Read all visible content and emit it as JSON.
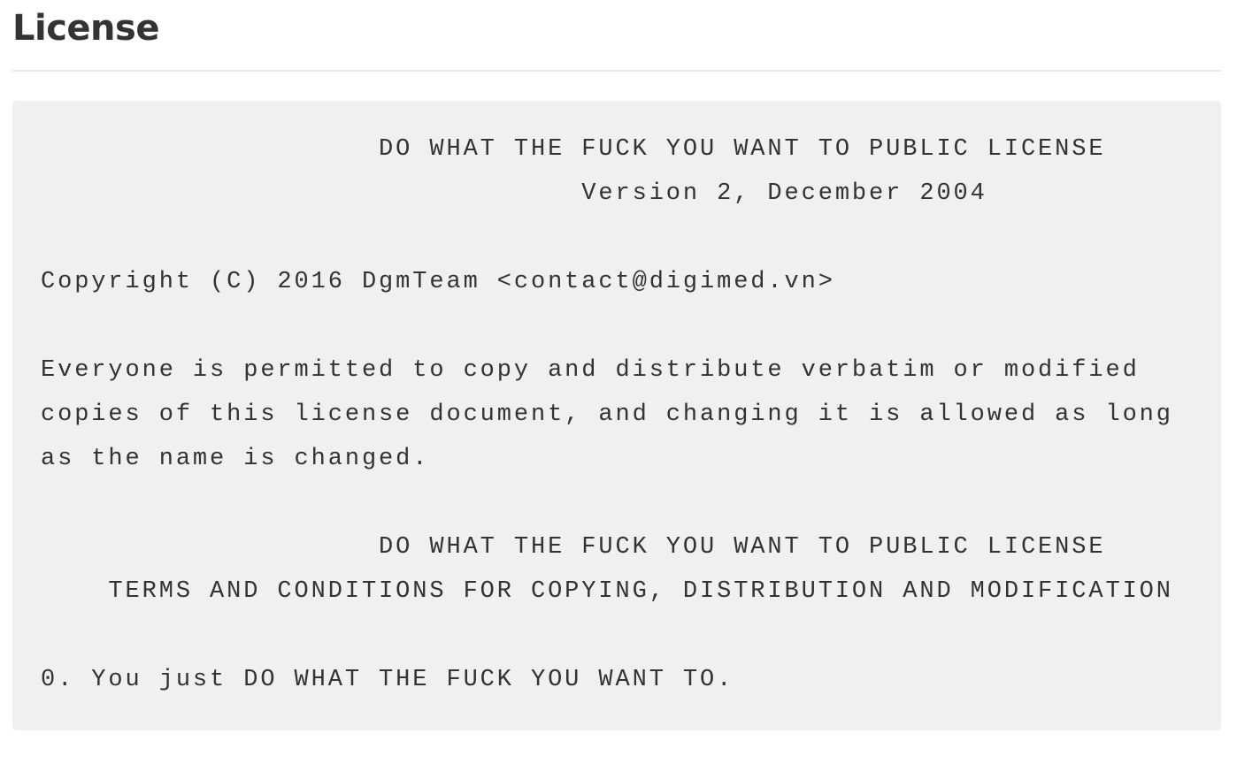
{
  "section": {
    "title": "License"
  },
  "license": {
    "text": "                    DO WHAT THE FUCK YOU WANT TO PUBLIC LICENSE\n                                Version 2, December 2004\n\nCopyright (C) 2016 DgmTeam <contact@digimed.vn>\n\nEveryone is permitted to copy and distribute verbatim or modified\ncopies of this license document, and changing it is allowed as long\nas the name is changed.\n\n                    DO WHAT THE FUCK YOU WANT TO PUBLIC LICENSE\n    TERMS AND CONDITIONS FOR COPYING, DISTRIBUTION AND MODIFICATION\n\n0. You just DO WHAT THE FUCK YOU WANT TO."
  }
}
